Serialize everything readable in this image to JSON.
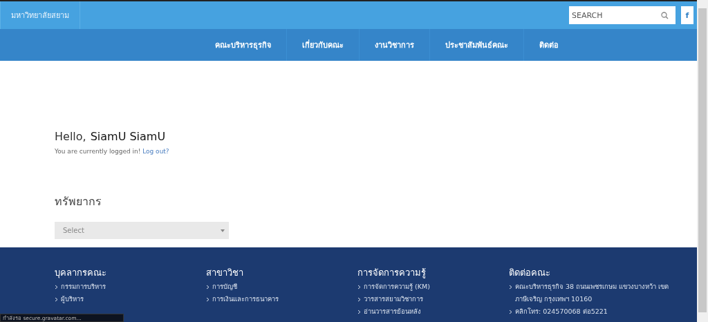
{
  "topbar": {
    "site_name": "มหาวิทยาลัยสยาม",
    "search": {
      "placeholder": "SEARCH"
    },
    "social": "f"
  },
  "nav": [
    {
      "label": "คณะบริหารธุรกิจ"
    },
    {
      "label": "เกี่ยวกับคณะ"
    },
    {
      "label": "งานวิชาการ"
    },
    {
      "label": "ประชาสัมพันธ์คณะ"
    },
    {
      "label": "ติดต่อ"
    }
  ],
  "greeting": {
    "hello": "Hello,",
    "name": "SiamU  SiamU",
    "status": "You are currently logged in!",
    "logout": "Log out?"
  },
  "resources": {
    "title": "ทรัพยากร",
    "select": {
      "placeholder": "Select"
    }
  },
  "footer": [
    {
      "title": "บุคลากรคณะ",
      "items": [
        "กรรมการบริหาร",
        "ผู้บริหาร"
      ]
    },
    {
      "title": "สาขาวิชา",
      "items": [
        "การบัญชี",
        "การเงินและการธนาคาร"
      ]
    },
    {
      "title": "การจัดการความรู้",
      "items": [
        "การจัดการความรู้ (KM)",
        "วารสารสยามวิชาการ",
        "อ่านวารสารย้อนหลัง"
      ]
    },
    {
      "title": "ติดต่อคณะ",
      "items": [
        "คณะบริหารธุรกิจ 38 ถนนเพชรเกษม แขวงบางหว้า เขตภาษีเจริญ กรุงเทพฯ 10160",
        "คลิกโทร: 024570068 ต่อ5221"
      ]
    }
  ],
  "status_bar": "กำลังรอ secure.gravatar.com..."
}
